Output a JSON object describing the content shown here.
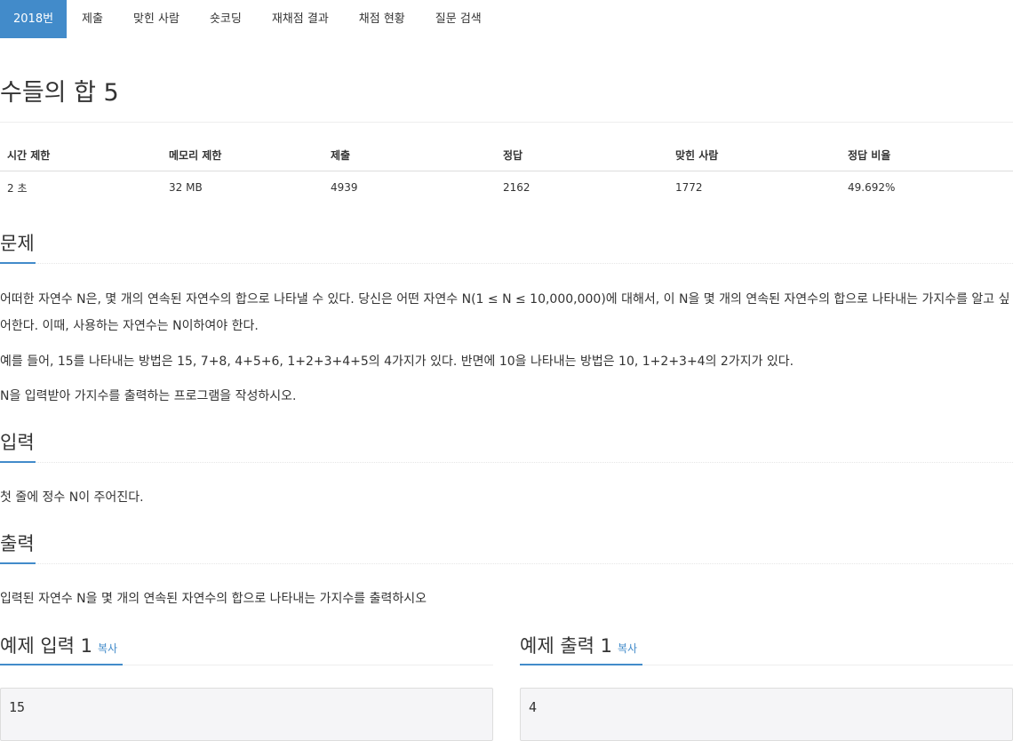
{
  "tabs": [
    {
      "label": "2018번",
      "active": true
    },
    {
      "label": "제출"
    },
    {
      "label": "맞힌 사람"
    },
    {
      "label": "숏코딩"
    },
    {
      "label": "재채점 결과"
    },
    {
      "label": "채점 현황"
    },
    {
      "label": "질문 검색"
    }
  ],
  "problem": {
    "title": "수들의 합 5"
  },
  "info_table": {
    "headers": [
      "시간 제한",
      "메모리 제한",
      "제출",
      "정답",
      "맞힌 사람",
      "정답 비율"
    ],
    "values": [
      "2 초",
      "32 MB",
      "4939",
      "2162",
      "1772",
      "49.692%"
    ]
  },
  "sections": {
    "description": {
      "heading": "문제",
      "paragraphs": [
        "어떠한 자연수 N은, 몇 개의 연속된 자연수의 합으로 나타낼 수 있다. 당신은 어떤 자연수 N(1 ≤ N ≤ 10,000,000)에 대해서, 이 N을 몇 개의 연속된 자연수의 합으로 나타내는 가지수를 알고 싶어한다. 이때, 사용하는 자연수는 N이하여야 한다.",
        "예를 들어, 15를 나타내는 방법은 15, 7+8, 4+5+6, 1+2+3+4+5의 4가지가 있다. 반면에 10을 나타내는 방법은 10, 1+2+3+4의 2가지가 있다.",
        "N을 입력받아 가지수를 출력하는 프로그램을 작성하시오."
      ]
    },
    "input": {
      "heading": "입력",
      "text": "첫 줄에 정수 N이 주어진다."
    },
    "output": {
      "heading": "출력",
      "text": "입력된 자연수 N을 몇 개의 연속된 자연수의 합으로 나타내는 가지수를 출력하시오"
    }
  },
  "samples": {
    "input": {
      "heading": "예제 입력 1",
      "copy_label": "복사",
      "content": "15"
    },
    "output": {
      "heading": "예제 출력 1",
      "copy_label": "복사",
      "content": "4"
    }
  },
  "colors": {
    "accent": "#428bca",
    "pre_background": "#f5f5f7"
  }
}
